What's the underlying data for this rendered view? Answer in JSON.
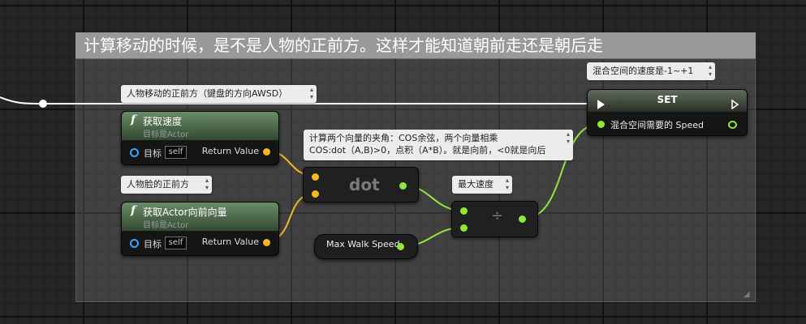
{
  "comment": {
    "title": "计算移动的时候，是不是人物的正前方。这样才能知道朝前走还是朝后走"
  },
  "bubbles": {
    "forward_move": "人物移动的正前方（键盘的方向AWSD）",
    "face_forward": "人物脸的正前方",
    "dot_angle_line1": "计算两个向量的夹角：COS余弦，两个向量相乘",
    "dot_angle_line2": "COS:dot（A,B)>0，点积（A*B）。就是向前，<0就是向后",
    "max_speed": "最大速度",
    "blend_speed": "混合空间的速度是-1~+1"
  },
  "nodes": {
    "get_velocity": {
      "title": "获取速度",
      "subtitle": "目标是Actor",
      "target_label": "目标",
      "self_label": "self",
      "return_label": "Return Value"
    },
    "get_forward": {
      "title": "获取Actor向前向量",
      "subtitle": "目标是Actor",
      "target_label": "目标",
      "self_label": "self",
      "return_label": "Return Value"
    },
    "dot": {
      "label": "dot"
    },
    "divide": {
      "label": "÷"
    },
    "max_walk_speed": {
      "label": "Max Walk Speed"
    },
    "set": {
      "title": "SET",
      "var_label": "混合空间需要的 Speed"
    }
  },
  "icons": {
    "function": "function-icon",
    "target_pin": "object-reference-pin-icon",
    "exec": "exec-arrow-icon"
  },
  "colors": {
    "vector_pin": "#f5b820",
    "float_pin": "#8fe83a",
    "object_pin": "#3ba3ff",
    "exec_wire": "#ffffff",
    "comment_header": "#999999"
  }
}
